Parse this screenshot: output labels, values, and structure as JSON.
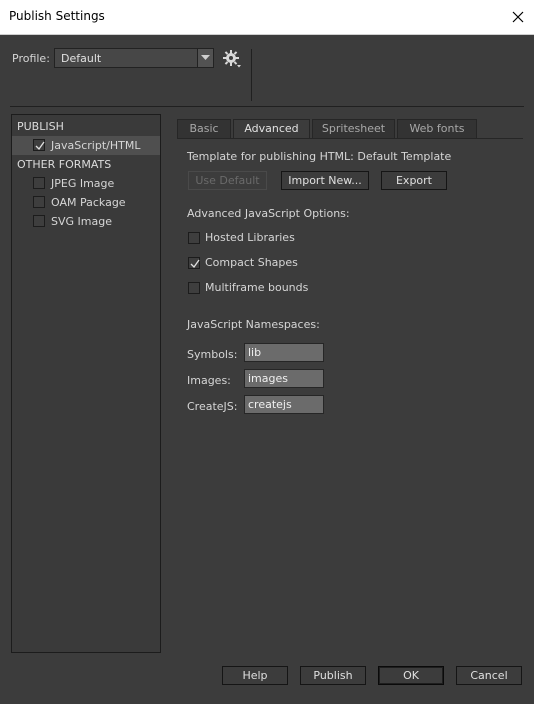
{
  "window": {
    "title": "Publish Settings"
  },
  "profile": {
    "label": "Profile:",
    "value": "Default"
  },
  "left_panel": {
    "publish_heading": "PUBLISH",
    "publish_items": [
      {
        "label": "JavaScript/HTML",
        "checked": true
      }
    ],
    "other_heading": "OTHER FORMATS",
    "other_items": [
      {
        "label": "JPEG Image",
        "checked": false
      },
      {
        "label": "OAM Package",
        "checked": false
      },
      {
        "label": "SVG Image",
        "checked": false
      }
    ]
  },
  "tabs": [
    {
      "label": "Basic",
      "active": false
    },
    {
      "label": "Advanced",
      "active": true
    },
    {
      "label": "Spritesheet",
      "active": false
    },
    {
      "label": "Web fonts",
      "active": false
    }
  ],
  "advanced": {
    "template_text": "Template for publishing HTML: Default Template",
    "buttons": {
      "use_default": "Use Default",
      "import_new": "Import New...",
      "export": "Export"
    },
    "js_options_heading": "Advanced JavaScript Options:",
    "options": [
      {
        "label": "Hosted Libraries",
        "checked": false
      },
      {
        "label": "Compact Shapes",
        "checked": true
      },
      {
        "label": "Multiframe bounds",
        "checked": false
      }
    ],
    "namespaces_heading": "JavaScript Namespaces:",
    "namespaces": {
      "symbols": {
        "label": "Symbols:",
        "value": "lib"
      },
      "images": {
        "label": "Images:",
        "value": "images"
      },
      "createjs": {
        "label": "CreateJS:",
        "value": "createjs"
      }
    }
  },
  "footer": {
    "help": "Help",
    "publish": "Publish",
    "ok": "OK",
    "cancel": "Cancel"
  }
}
